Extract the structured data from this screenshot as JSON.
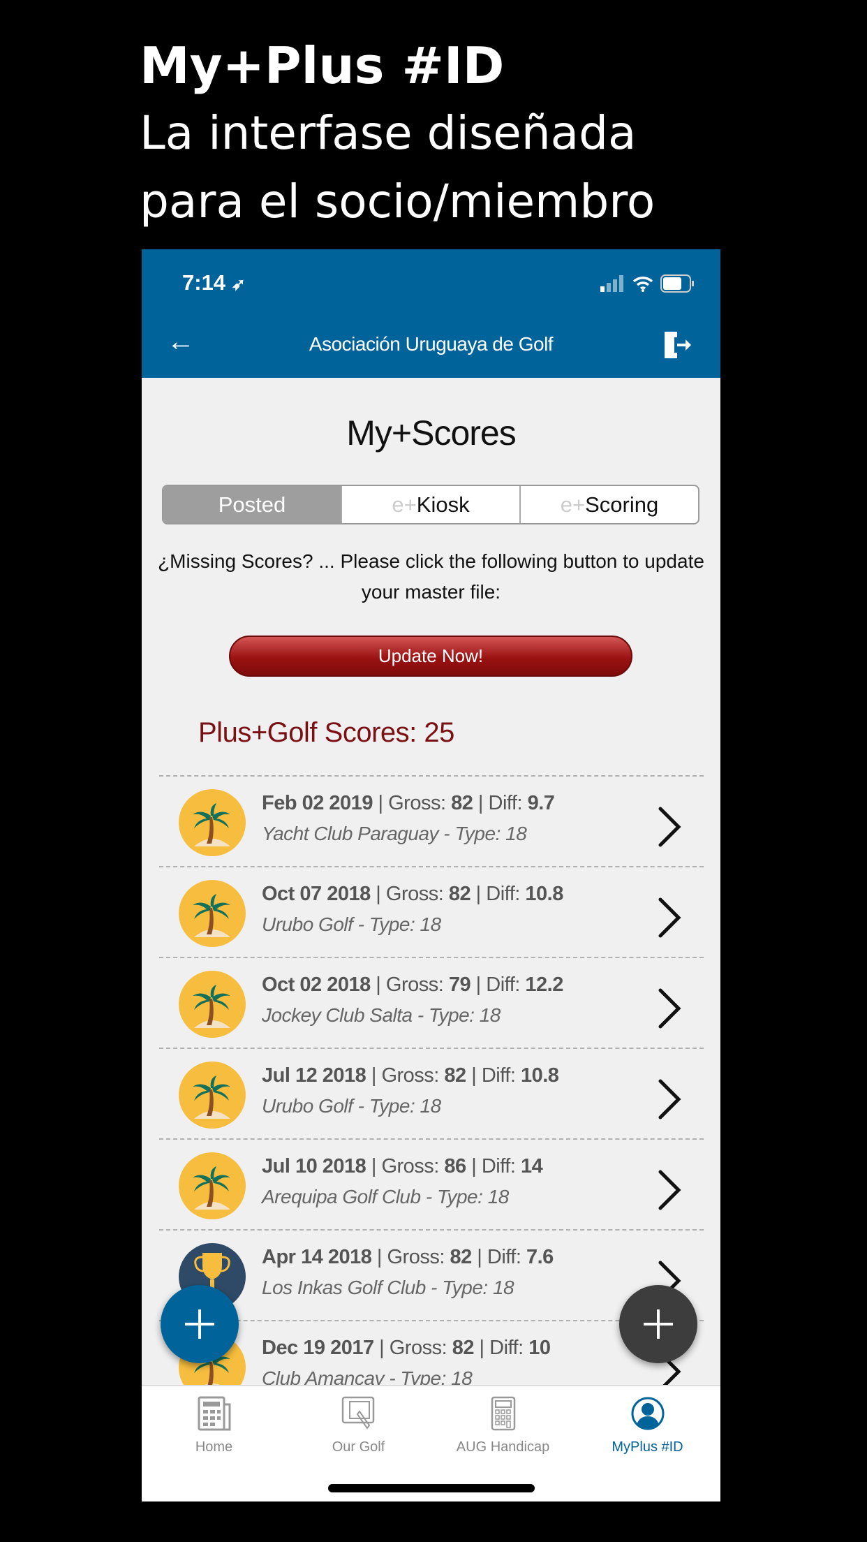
{
  "headline": {
    "line1": "My+Plus #ID",
    "line2": "La interfase diseñada",
    "line3": "para el socio/miembro"
  },
  "status_bar": {
    "time": "7:14"
  },
  "header": {
    "title": "Asociación Uruguaya de Golf",
    "back_icon": "arrow-left-icon",
    "exit_icon": "exit-door-icon",
    "color": "#00639a"
  },
  "page_title": "My+Scores",
  "segments": [
    {
      "prefix": "",
      "label": "Posted",
      "active": true
    },
    {
      "prefix": "e+",
      "label": "Kiosk"
    },
    {
      "prefix": "e+",
      "label": "Scoring"
    }
  ],
  "missing_text": "¿Missing Scores? ... Please click the following button to update your master file:",
  "update_button": "Update Now!",
  "scores_count": "Plus+Golf Scores: 25",
  "scores": [
    {
      "date": "Feb 02 2019",
      "gross": "82",
      "diff": "9.7",
      "club": "Yacht Club Paraguay - Type: 18",
      "icon": "palm-tree-icon"
    },
    {
      "date": "Oct 07 2018",
      "gross": "82",
      "diff": "10.8",
      "club": "Urubo Golf - Type: 18",
      "icon": "palm-tree-icon"
    },
    {
      "date": "Oct 02 2018",
      "gross": "79",
      "diff": "12.2",
      "club": "Jockey Club Salta - Type: 18",
      "icon": "palm-tree-icon"
    },
    {
      "date": "Jul 12 2018",
      "gross": "82",
      "diff": "10.8",
      "club": "Urubo Golf - Type: 18",
      "icon": "palm-tree-icon"
    },
    {
      "date": "Jul 10 2018",
      "gross": "86",
      "diff": "14",
      "club": "Arequipa Golf Club - Type: 18",
      "icon": "palm-tree-icon"
    },
    {
      "date": "Apr 14 2018",
      "gross": "82",
      "diff": "7.6",
      "club": "Los Inkas Golf Club - Type: 18",
      "icon": "trophy-icon"
    },
    {
      "date": "Dec 19 2017",
      "gross": "82",
      "diff": "10",
      "club": "Club Amancay - Type: 18",
      "icon": "palm-tree-icon"
    }
  ],
  "labels": {
    "gross": "Gross:",
    "diff": "Diff:",
    "sep": " | "
  },
  "tabs": [
    {
      "label": "Home"
    },
    {
      "label": "Our Golf"
    },
    {
      "label": "AUG Handicap"
    },
    {
      "label": "MyPlus #ID",
      "active": true
    }
  ]
}
